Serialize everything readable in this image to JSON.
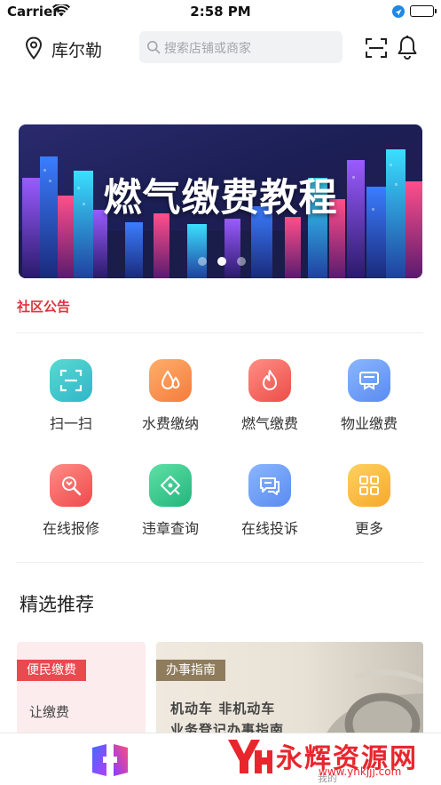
{
  "status_bar": {
    "carrier": "Carrier",
    "time": "2:58 PM"
  },
  "header": {
    "city": "库尔勒",
    "search_placeholder": "搜索店铺或商家"
  },
  "banner": {
    "title": "燃气缴费教程",
    "dots": 3,
    "active_dot": 2
  },
  "notice": {
    "label": "社区公告"
  },
  "services": [
    {
      "label": "扫一扫",
      "icon": "scan-icon",
      "color_from": "#5ad9d1",
      "color_to": "#2fb6c9"
    },
    {
      "label": "水费缴纳",
      "icon": "water-drop-icon",
      "color_from": "#ffae6b",
      "color_to": "#f47c3c"
    },
    {
      "label": "燃气缴费",
      "icon": "flame-icon",
      "color_from": "#ff8e84",
      "color_to": "#ec4d48"
    },
    {
      "label": "物业缴费",
      "icon": "property-icon",
      "color_from": "#8ab6ff",
      "color_to": "#5a8bf0"
    },
    {
      "label": "在线报修",
      "icon": "wrench-icon",
      "color_from": "#ff8c86",
      "color_to": "#ee4a4c"
    },
    {
      "label": "违章查询",
      "icon": "violation-icon",
      "color_from": "#5fe0a6",
      "color_to": "#22b57c"
    },
    {
      "label": "在线投诉",
      "icon": "complaint-icon",
      "color_from": "#8ab6ff",
      "color_to": "#5a8bf0"
    },
    {
      "label": "更多",
      "icon": "more-grid-icon",
      "color_from": "#ffd160",
      "color_to": "#f6a92a"
    }
  ],
  "featured": {
    "title": "精选推荐",
    "left_card": {
      "tag": "便民缴费",
      "text": "让缴费"
    },
    "right_card": {
      "tag": "办事指南",
      "line1": "机动车 非机动车",
      "line2": "业务登记办事指南"
    }
  },
  "tab_bar": {
    "mine_label": "我的"
  },
  "watermark": {
    "text": "永辉资源网",
    "url": "www.yhkjjj.com"
  }
}
